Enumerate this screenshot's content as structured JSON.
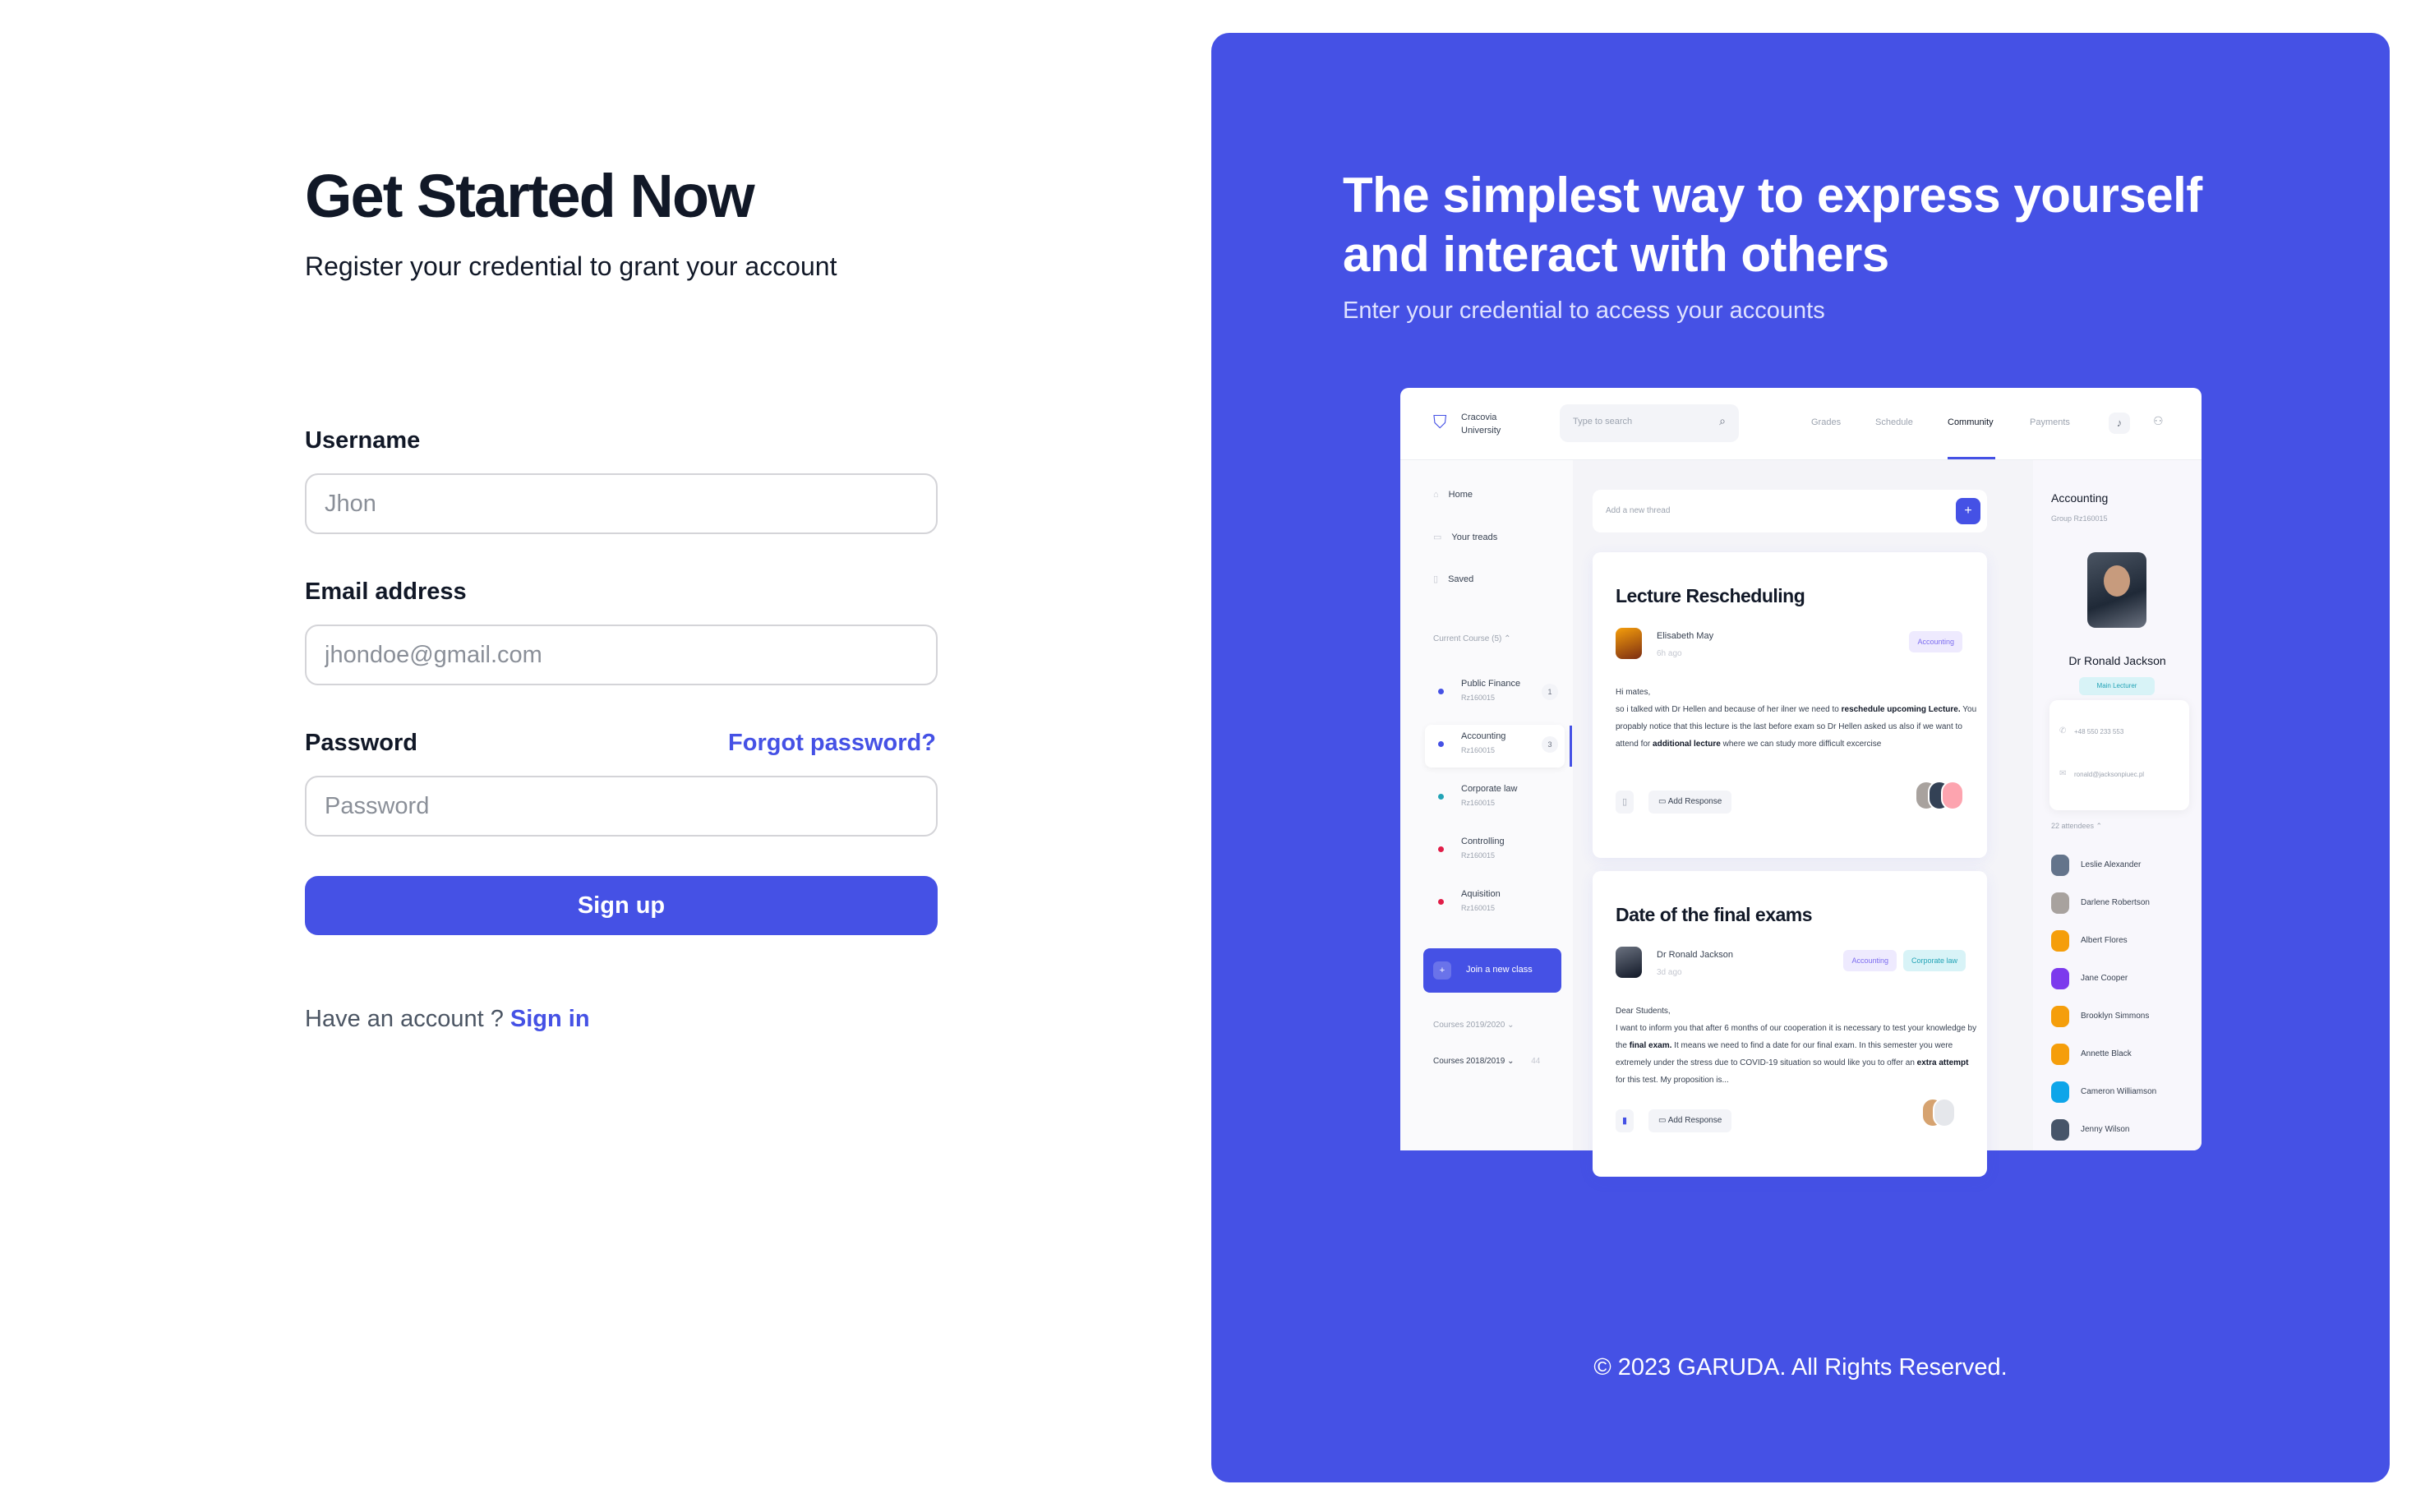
{
  "form": {
    "title": "Get Started Now",
    "subtitle": "Register your credential to grant your account",
    "username_label": "Username",
    "username_placeholder": "Jhon",
    "email_label": "Email address",
    "email_placeholder": "jhondoe@gmail.com",
    "password_label": "Password",
    "forgot_label": "Forgot password?",
    "password_placeholder": "Password",
    "submit_label": "Sign up",
    "have_account_text": "Have an account ?",
    "signin_label": "Sign in"
  },
  "panel": {
    "headline": "The simplest way to express yourself and interact with others",
    "subline": "Enter your credential to access your accounts",
    "copyright": "© 2023 GARUDA. All Rights Reserved.",
    "accent": "#4551e5"
  },
  "mockup": {
    "university": "Cracovia University",
    "search_placeholder": "Type to search",
    "nav": [
      "Grades",
      "Schedule",
      "Community",
      "Payments"
    ],
    "active_nav": "Community",
    "sidebar": {
      "items": [
        "Home",
        "Your treads",
        "Saved"
      ],
      "current_course": "Current Course (5)",
      "courses": [
        {
          "name": "Public Finance",
          "code": "Rz160015",
          "badge": "1",
          "color": "#4551e5"
        },
        {
          "name": "Accounting",
          "code": "Rz160015",
          "badge": "3",
          "color": "#4551e5"
        },
        {
          "name": "Corporate law",
          "code": "Rz160015",
          "badge": "",
          "color": "#22a3b6"
        },
        {
          "name": "Controlling",
          "code": "Rz160015",
          "badge": "",
          "color": "#e11d48"
        },
        {
          "name": "Aquisition",
          "code": "Rz160015",
          "badge": "",
          "color": "#e11d48"
        }
      ],
      "join_label": "Join a new class",
      "courses_2019": "Courses 2019/2020",
      "courses_2018": "Courses 2018/2019",
      "courses_2018_count": "44"
    },
    "thread_placeholder": "Add a new thread",
    "posts": [
      {
        "title": "Lecture Rescheduling",
        "author": "Elisabeth May",
        "time": "6h ago",
        "tags": [
          "Accounting"
        ],
        "greeting": "Hi mates,",
        "body_1": "so i talked with Dr Hellen and because of her ilner we need to ",
        "bold_1": "reschedule upcoming Lecture.",
        "body_2": " You propably notice that this lecture is the last before exam so Dr Hellen asked us also if we want to attend for ",
        "bold_2": "additional lecture",
        "body_3": " where we can study more difficult excercise",
        "response_label": "Add Response"
      },
      {
        "title": "Date of the final exams",
        "author": "Dr Ronald Jackson",
        "time": "3d ago",
        "tags": [
          "Accounting",
          "Corporate law"
        ],
        "greeting": "Dear Students,",
        "body_1": "I want to inform you that after 6 months of our cooperation it is necessary to test your knowledge by the ",
        "bold_1": "final exam.",
        "body_2": " It means we need to find a date for our final exam. In this semester you were extremely under the stress due to COVID-19 situation so would like you to offer an ",
        "bold_2": "extra attempt",
        "body_3": " for this test. My proposition is...",
        "response_label": "Add Response"
      }
    ],
    "right": {
      "title": "Accounting",
      "group": "Group Rz160015",
      "lecturer": "Dr Ronald Jackson",
      "lecturer_badge": "Main Lecturer",
      "phone": "+48 550 233 553",
      "email": "ronald@jacksonpiuec.pl",
      "attendees_label": "22 attendees",
      "attendees": [
        "Leslie Alexander",
        "Darlene Robertson",
        "Albert Flores",
        "Jane Cooper",
        "Brooklyn Simmons",
        "Annette Black",
        "Cameron Williamson",
        "Jenny Wilson"
      ],
      "attendee_colors": [
        "#64748b",
        "#a8a29e",
        "#f59e0b",
        "#7c3aed",
        "#f59e0b",
        "#f59e0b",
        "#0ea5e9",
        "#475569"
      ]
    }
  }
}
